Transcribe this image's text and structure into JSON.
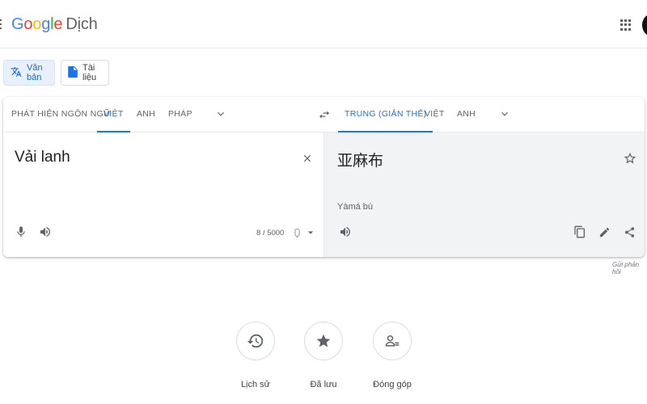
{
  "app": {
    "logo_text": "Google",
    "logo_suffix": "Dịch",
    "menu_icon": "more-vert-icon",
    "apps_icon": "apps-grid-icon"
  },
  "modes": [
    {
      "label": "Văn bản",
      "icon": "translate-icon",
      "active": true
    },
    {
      "label": "Tài liệu",
      "icon": "document-icon",
      "active": false
    }
  ],
  "source_langs": [
    {
      "label": "PHÁT HIỆN NGÔN NGỮ",
      "active": false
    },
    {
      "label": "VIỆT",
      "active": true
    },
    {
      "label": "ANH",
      "active": false
    },
    {
      "label": "PHÁP",
      "active": false
    }
  ],
  "target_langs": [
    {
      "label": "TRUNG (GIẢN THỂ)",
      "active": true
    },
    {
      "label": "VIỆT",
      "active": false
    },
    {
      "label": "ANH",
      "active": false
    }
  ],
  "source": {
    "text": "Vải lanh",
    "char_count": "8 / 5000"
  },
  "target": {
    "text": "亚麻布",
    "romanization": "Yàmá bù"
  },
  "feedback_label": "Gửi phản hồi",
  "bottom_actions": [
    {
      "label": "Lịch sử",
      "icon": "history-icon"
    },
    {
      "label": "Đã lưu",
      "icon": "star-icon"
    },
    {
      "label": "Đóng góp",
      "icon": "community-icon"
    }
  ],
  "colors": {
    "accent": "#1a73e8",
    "target_bg": "#f1f3f4",
    "icon": "#5f6368"
  }
}
